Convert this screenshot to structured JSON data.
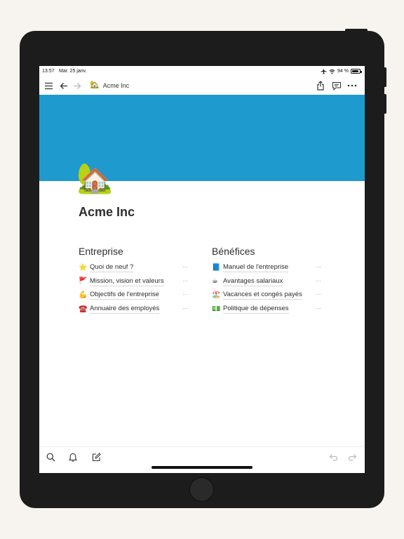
{
  "status_bar": {
    "time": "13:57",
    "date": "Mar. 25 janv.",
    "battery_text": "94 %",
    "battery_level": 0.94
  },
  "nav_bar": {
    "breadcrumb_emoji": "🏡",
    "breadcrumb_title": "Acme Inc",
    "icons": [
      "menu-icon",
      "back-arrow-icon",
      "forward-arrow-icon",
      "share-icon",
      "comment-icon",
      "more-icon"
    ]
  },
  "cover": {
    "color": "#1f9ace"
  },
  "page": {
    "icon_emoji": "🏡",
    "title": "Acme Inc"
  },
  "columns": [
    {
      "heading": "Entreprise",
      "items": [
        {
          "emoji": "⭐",
          "label": "Quoi de neuf ?"
        },
        {
          "emoji": "🚩",
          "label": "Mission, vision et valeurs"
        },
        {
          "emoji": "💪",
          "label": "Objectifs de l'entreprise"
        },
        {
          "emoji": "☎️",
          "label": "Annuaire des employés"
        }
      ]
    },
    {
      "heading": "Bénéfices",
      "items": [
        {
          "emoji": "📘",
          "label": "Manuel de l'entreprise"
        },
        {
          "emoji": "☕",
          "label": "Avantages salariaux"
        },
        {
          "emoji": "🏖️",
          "label": "Vacances et congés payés"
        },
        {
          "emoji": "💵",
          "label": "Politique de dépenses"
        }
      ]
    }
  ],
  "more_glyph": "···",
  "bottom_toolbar": {
    "icons": [
      "search-icon",
      "bell-icon",
      "compose-icon",
      "undo-icon",
      "redo-icon"
    ]
  }
}
